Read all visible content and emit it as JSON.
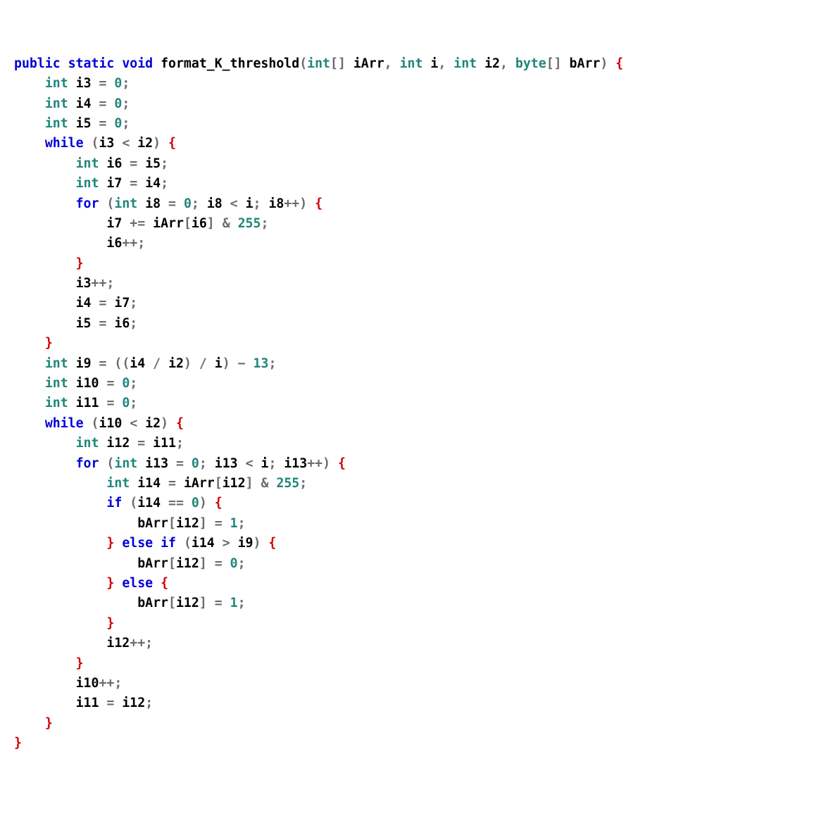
{
  "kw": {
    "public": "public",
    "static": "static",
    "void": "void",
    "while": "while",
    "for": "for",
    "if": "if",
    "else": "else"
  },
  "type": {
    "int": "int",
    "byte": "byte"
  },
  "fn": "format_K_threshold",
  "param": {
    "iArr": "iArr",
    "i": "i",
    "i2": "i2",
    "bArr": "bArr"
  },
  "var": {
    "i3": "i3",
    "i4": "i4",
    "i5": "i5",
    "i6": "i6",
    "i7": "i7",
    "i8": "i8",
    "i9": "i9",
    "i10": "i10",
    "i11": "i11",
    "i12": "i12",
    "i13": "i13",
    "i14": "i14"
  },
  "num": {
    "n0": "0",
    "n1": "1",
    "n13": "13",
    "n255": "255"
  },
  "p": {
    "lparen": "(",
    "rparen": ")",
    "lbrack": "[",
    "rbrack": "]",
    "lbrace": "{",
    "rbrace": "}",
    "semi": ";",
    "comma": ",",
    "eq": "=",
    "lt": "<",
    "gt": ">",
    "amp": "&",
    "plus": "+",
    "minus": "−",
    "slash": "/",
    "space": " ",
    "dblplus": "++",
    "pluseq": "+=",
    "eqeq": "=="
  },
  "indent": {
    "i1": "    ",
    "i2": "        ",
    "i3": "            ",
    "i4": "                ",
    "i5": "                    "
  }
}
